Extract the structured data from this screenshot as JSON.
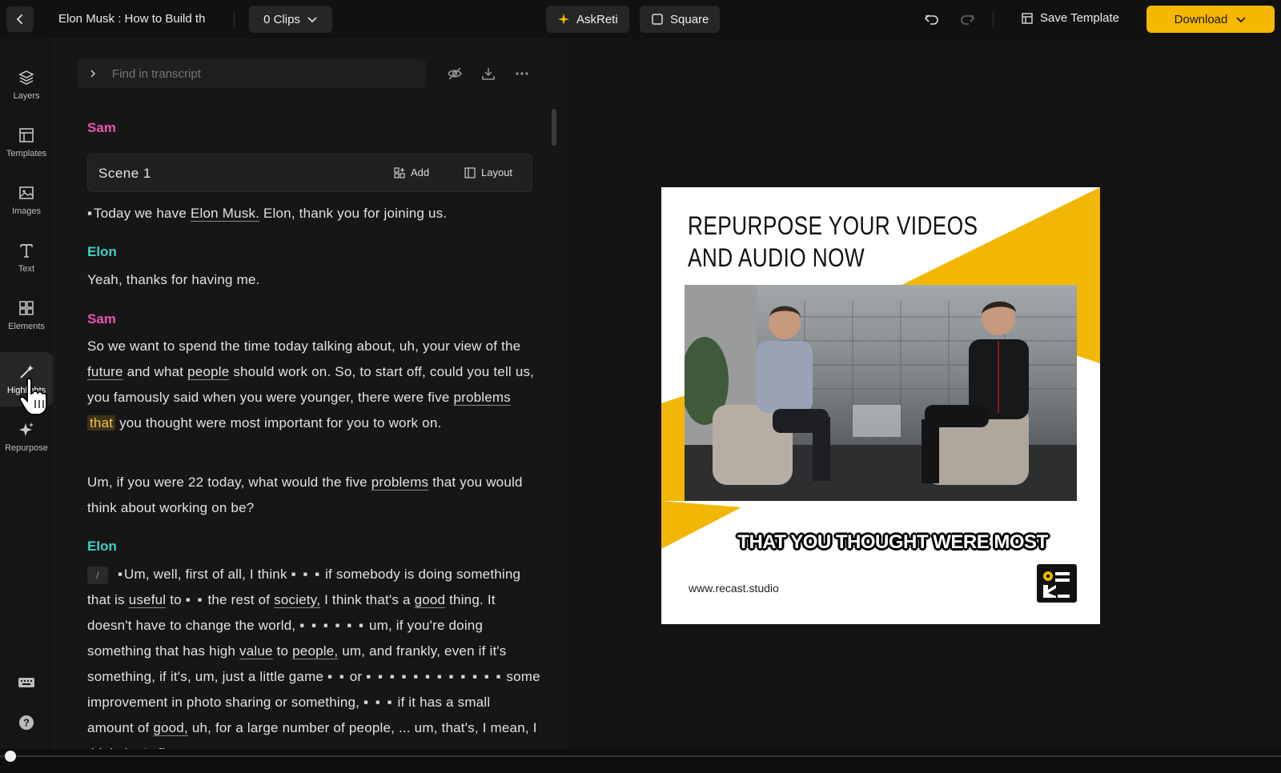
{
  "header": {
    "project_title": "Elon Musk : How to Build th",
    "clips_label": "0 Clips",
    "askreti_label": "AskReti",
    "aspect_label": "Square",
    "save_template_label": "Save Template",
    "download_label": "Download"
  },
  "sidebar": {
    "items": [
      {
        "label": "Layers",
        "icon": "layers-icon"
      },
      {
        "label": "Templates",
        "icon": "templates-icon"
      },
      {
        "label": "Images",
        "icon": "image-icon"
      },
      {
        "label": "Text",
        "icon": "text-icon"
      },
      {
        "label": "Elements",
        "icon": "elements-icon"
      },
      {
        "label": "Highlights",
        "icon": "magic-wand-icon",
        "active": true
      },
      {
        "label": "Repurpose",
        "icon": "sparkle-icon"
      }
    ],
    "bottom": [
      "keyboard-icon",
      "help-icon"
    ]
  },
  "transcript": {
    "search_placeholder": "Find in transcript",
    "scene": {
      "title": "Scene 1",
      "add_label": "Add",
      "layout_label": "Layout"
    },
    "speakers": {
      "sam": "Sam",
      "elon": "Elon"
    },
    "p1": {
      "a": "Today we have",
      "kw1": "Elon Musk.",
      "b": " Elon, thank you for joining us."
    },
    "p2": {
      "a": "Yeah, thanks for having me."
    },
    "p3": {
      "a": "So we want to spend the time today talking about, uh, your view of the",
      "kw1": "future",
      "b": " and what",
      "kw2": "people",
      "c": " should work on. So, to start off, could you tell us, you famously said when you were younger, there were five",
      "kw3": "problems",
      "hl": "that",
      "d": " you thought were most important for you to work on."
    },
    "p4": {
      "a": "Um, if you were 22 today, what would the five",
      "kw1": "problems",
      "b": " that you would think about working on be?"
    },
    "p5": {
      "chip": "/",
      "a": "Um, well, first of all, I think",
      "b": " if somebody is doing something that is",
      "kw1": "useful",
      "c": " to",
      "d": " the rest of",
      "kw2": "society,",
      "e": " I think that's a",
      "kw3": "good",
      "f": " thing. It doesn't have to change the world,",
      "g": " um, if you're doing something that has high",
      "kw4": "value",
      "h": " to",
      "kw5": "people,",
      "i": " um, and frankly, even if it's something, if it's, um, just a little game",
      "j": " or",
      "k": " some improvement in photo sharing or something,",
      "l": " if it has a small amount of",
      "kw6": "good,",
      "m": " uh, for a large number of people, ... um, that's, I mean, I think that's fine."
    }
  },
  "preview": {
    "headline_line1": "REPURPOSE YOUR VIDEOS",
    "headline_line2": "AND AUDIO NOW",
    "caption": "THAT YOU THOUGHT WERE MOST",
    "website": "www.recast.studio",
    "accent_color": "#f2b705"
  }
}
